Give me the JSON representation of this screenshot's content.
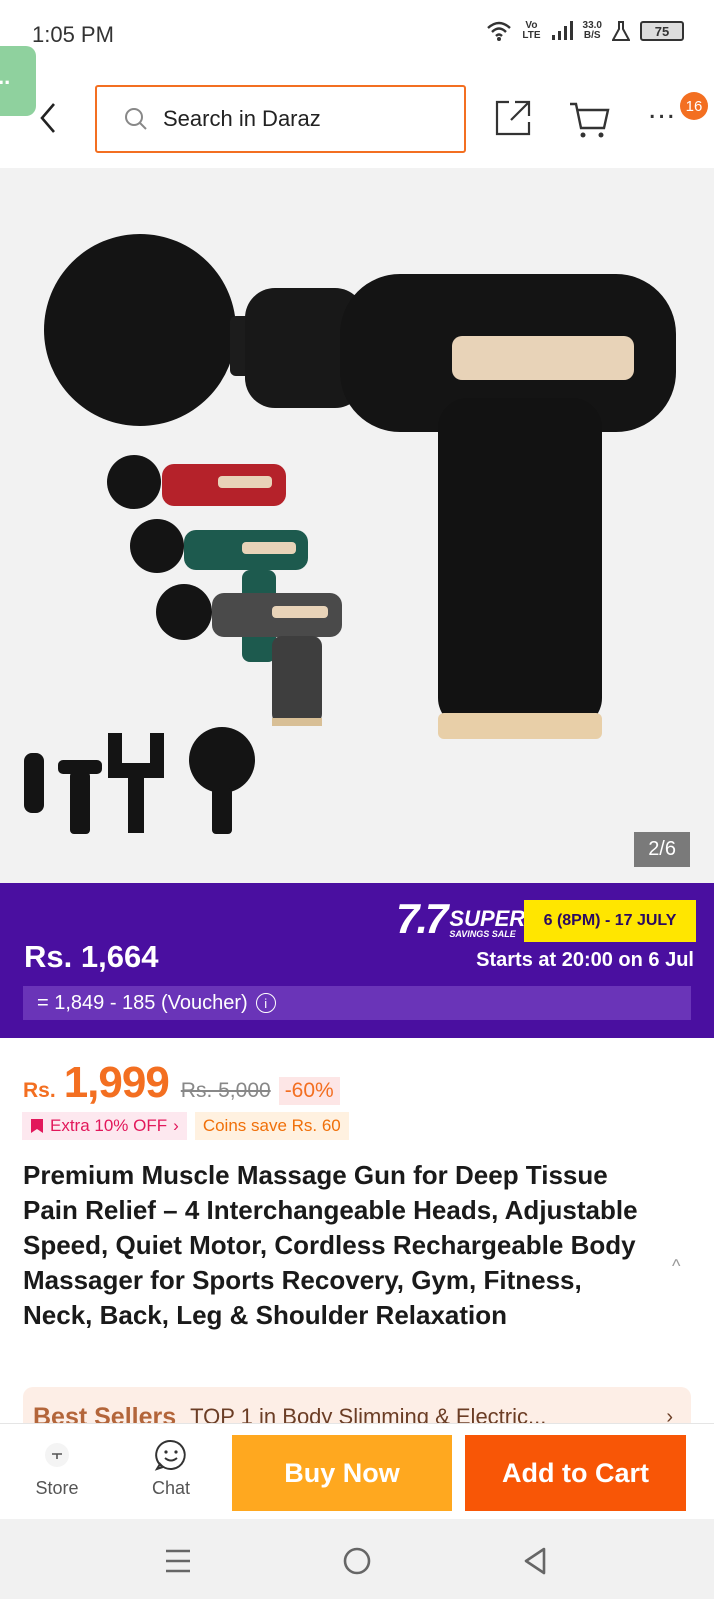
{
  "status_bar": {
    "time": "1:05 PM",
    "network_label_top": "Vo",
    "network_label_bottom": "LTE",
    "speed_top": "33.0",
    "speed_bottom": "B/S",
    "battery": "75"
  },
  "header": {
    "search_placeholder": "Search in Daraz",
    "cart_badge": "16",
    "side_tab": "..",
    "more_label": "..."
  },
  "gallery": {
    "counter": "2/6"
  },
  "promo": {
    "price": "Rs. 1,664",
    "logo_big": "7.7",
    "logo_small": "SUPER",
    "logo_tiny": "SAVINGS SALE",
    "dates": "6 (8PM) - 17 JULY",
    "start_text": "Starts at 20:00 on 6 Jul",
    "voucher_text": "= 1,849 - 185 (Voucher)",
    "info_symbol": "i"
  },
  "product": {
    "currency": "Rs.",
    "price": "1,999",
    "old_price": "Rs. 5,000",
    "discount": "-60%",
    "extra_off": "Extra 10% OFF",
    "extra_arrow": "›",
    "coins": "Coins save Rs. 60",
    "title": "Premium Muscle Massage Gun for Deep Tissue Pain Relief – 4 Interchangeable Heads, Adjustable Speed, Quiet Motor, Cordless Rechargeable Body Massager for Sports Recovery, Gym, Fitness, Neck, Back, Leg & Shoulder Relaxation",
    "collapse_symbol": "^"
  },
  "bestseller": {
    "label": "Best Sellers",
    "text": "TOP 1 in Body Slimming & Electric...",
    "arrow": "›"
  },
  "actions": {
    "store": "Store",
    "chat": "Chat",
    "buy_now": "Buy Now",
    "add_to_cart": "Add to Cart"
  },
  "colors": {
    "brand_orange": "#f85606",
    "buy_now": "#ffa81f",
    "promo_purple": "#4a0fa0",
    "promo_yellow": "#ffe600"
  },
  "icons": [
    "back-arrow-icon",
    "search-icon",
    "share-icon",
    "cart-icon",
    "more-icon",
    "info-icon",
    "voucher-icon",
    "store-icon",
    "chat-icon",
    "menu-icon",
    "home-icon",
    "back-icon",
    "wifi-icon",
    "signal-icon"
  ]
}
